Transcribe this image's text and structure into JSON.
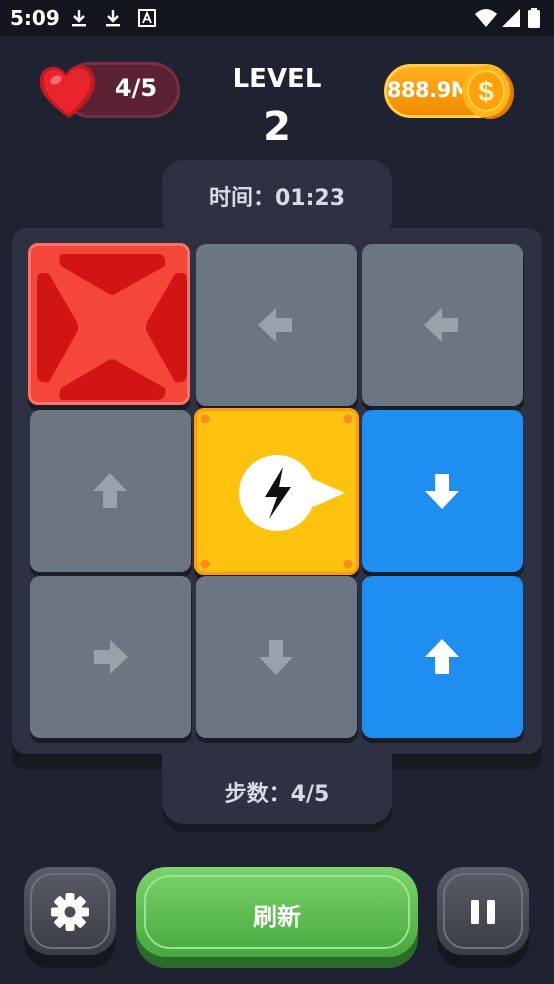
{
  "status_bar": {
    "time": "5:09",
    "icons": [
      "download-icon",
      "download-icon",
      "font-a-icon",
      "wifi-icon",
      "signal-icon",
      "battery-icon"
    ]
  },
  "header": {
    "hearts": "4/5",
    "level_label": "LEVEL",
    "level_value": "2",
    "coins": "888.9M"
  },
  "timer": {
    "text": "时间：01:23"
  },
  "board": {
    "rows": 3,
    "cols": 3,
    "tiles": [
      {
        "color": "red",
        "icon": "x-block-icon"
      },
      {
        "color": "gray",
        "icon": "arrow-left-icon"
      },
      {
        "color": "gray",
        "icon": "arrow-left-icon"
      },
      {
        "color": "gray",
        "icon": "arrow-up-icon"
      },
      {
        "color": "yellow",
        "icon": "lightning-icon"
      },
      {
        "color": "blue",
        "icon": "arrow-down-icon"
      },
      {
        "color": "gray",
        "icon": "arrow-right-icon"
      },
      {
        "color": "gray",
        "icon": "arrow-down-icon"
      },
      {
        "color": "blue",
        "icon": "arrow-up-icon"
      }
    ]
  },
  "steps": {
    "text": "步数：4/5"
  },
  "controls": {
    "settings_icon": "gear-icon",
    "refresh_label": "刷新",
    "pause_icon": "pause-icon"
  },
  "colors": {
    "background": "#1f2230",
    "panel": "#2e3142",
    "tile_gray": "#6c7582",
    "tile_blue": "#1e8ff0",
    "tile_yellow": "#ffc20e",
    "tile_red": "#f4463b",
    "refresh_green": "#46a83e"
  }
}
